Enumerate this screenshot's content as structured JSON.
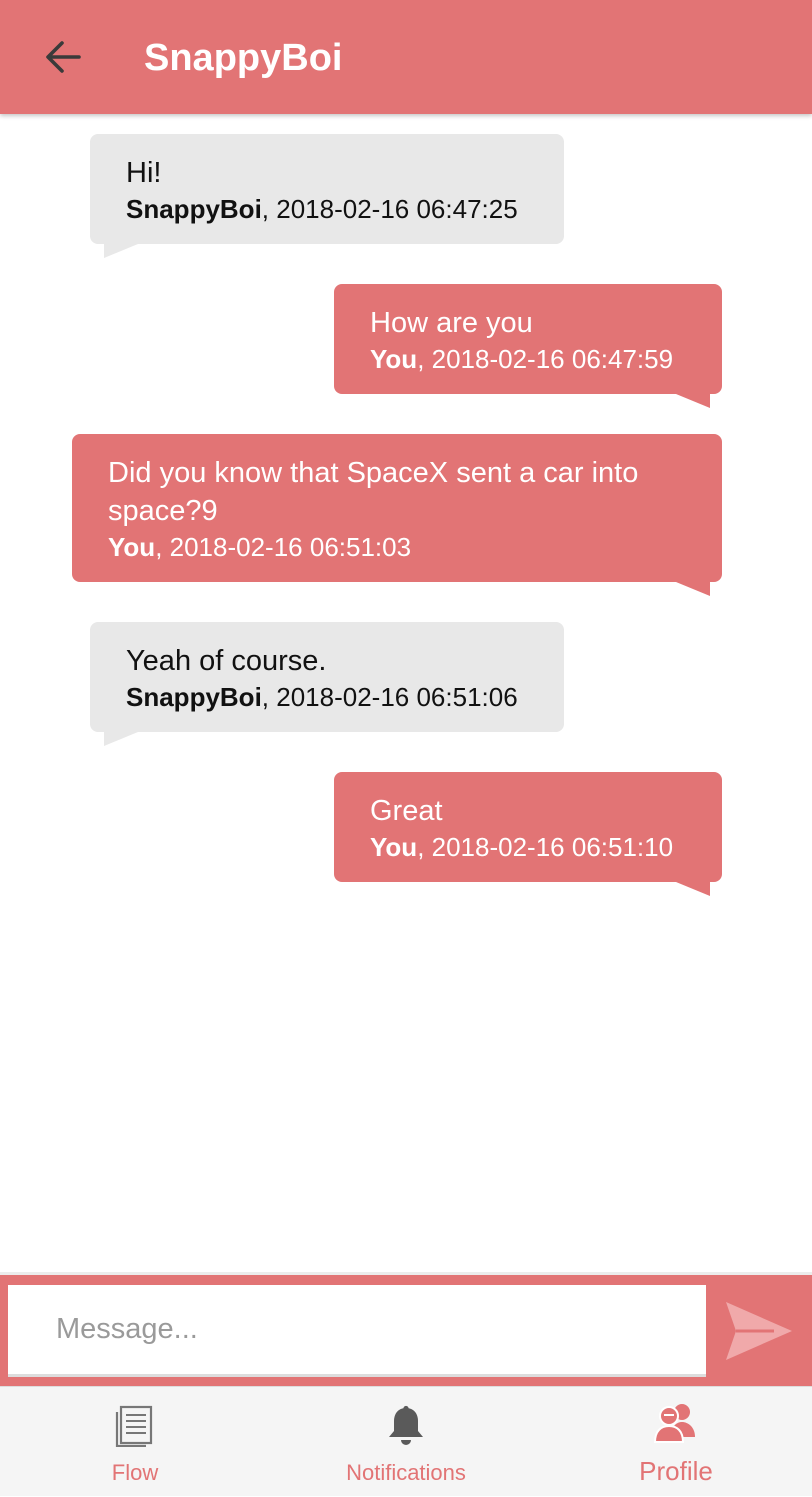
{
  "header": {
    "title": "SnappyBoi",
    "back_icon": "arrow-left-icon"
  },
  "messages": [
    {
      "direction": "incoming",
      "text": "Hi!",
      "author": "SnappyBoi",
      "timestamp": ", 2018-02-16 06:47:25"
    },
    {
      "direction": "outgoing",
      "text": "How are you",
      "author": "You",
      "timestamp": ", 2018-02-16 06:47:59"
    },
    {
      "direction": "outgoing",
      "text": "Did you know that SpaceX sent a car into space?9",
      "author": "You",
      "timestamp": ", 2018-02-16 06:51:03"
    },
    {
      "direction": "incoming",
      "text": "Yeah of course.",
      "author": "SnappyBoi",
      "timestamp": ", 2018-02-16 06:51:06"
    },
    {
      "direction": "outgoing",
      "text": "Great",
      "author": "You",
      "timestamp": ", 2018-02-16 06:51:10"
    }
  ],
  "composer": {
    "placeholder": "Message...",
    "value": "",
    "send_icon": "send-icon"
  },
  "bottom_nav": {
    "items": [
      {
        "label": "Flow",
        "icon": "document-list-icon"
      },
      {
        "label": "Notifications",
        "icon": "bell-icon"
      },
      {
        "label": "Profile",
        "icon": "people-icon",
        "active": true
      }
    ]
  },
  "colors": {
    "accent": "#e27475",
    "incoming_bubble": "#e8e8e8",
    "nav_background": "#f5f5f5"
  }
}
